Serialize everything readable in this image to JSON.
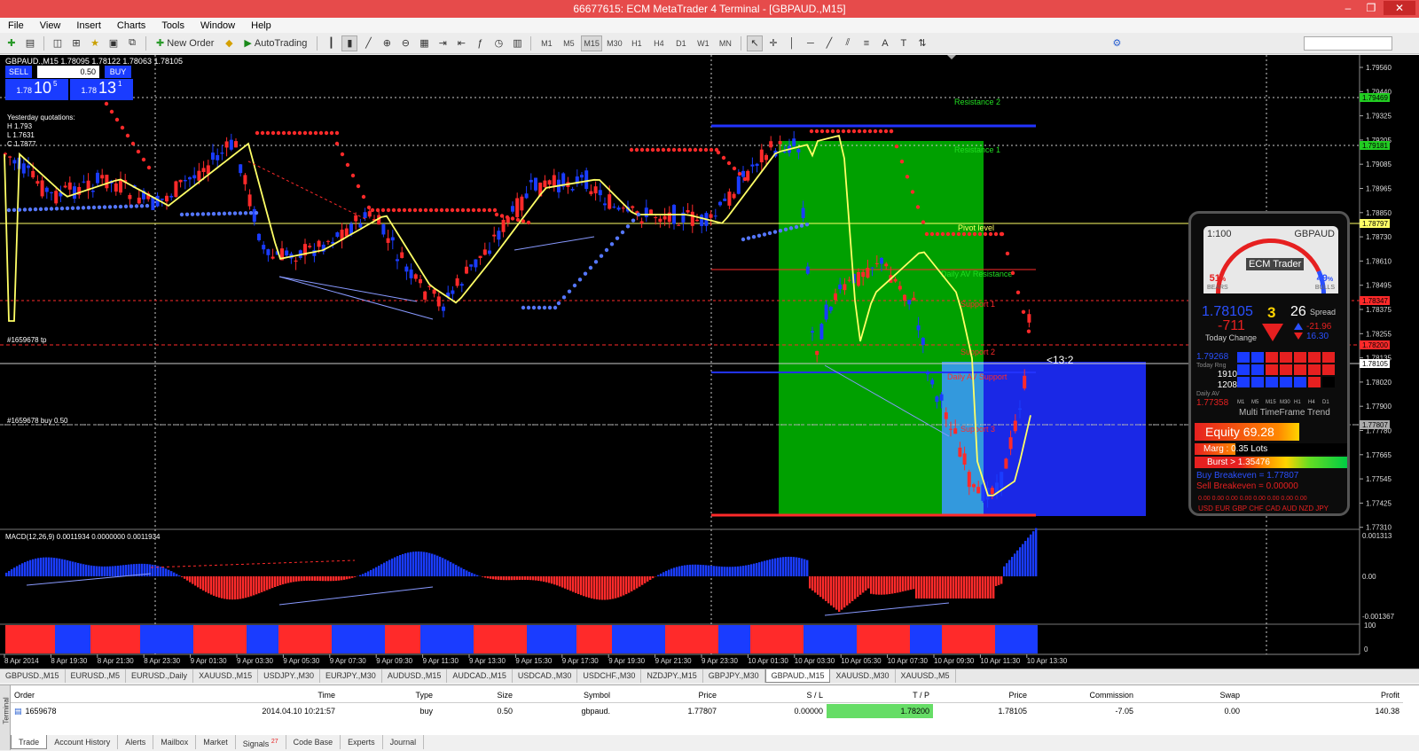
{
  "window": {
    "title": "66677615: ECM MetaTrader 4 Terminal - [GBPAUD.,M15]"
  },
  "menu": [
    "File",
    "View",
    "Insert",
    "Charts",
    "Tools",
    "Window",
    "Help"
  ],
  "toolbar": {
    "new_order": "New Order",
    "autotrading": "AutoTrading",
    "timeframes": [
      "M1",
      "M5",
      "M15",
      "M30",
      "H1",
      "H4",
      "D1",
      "W1",
      "MN"
    ],
    "active_timeframe": "M15"
  },
  "chart": {
    "symbol_label": "GBPAUD.,M15  1.78095 1.78122 1.78063 1.78105",
    "trade_panel": {
      "sell": "SELL",
      "buy": "BUY",
      "lot": "0.50",
      "sell_price_small": "1.78",
      "sell_price_big": "10",
      "sell_price_sup": "5",
      "buy_price_small": "1.78",
      "buy_price_big": "13",
      "buy_price_sup": "1"
    },
    "yesterday": [
      "Yesterday quotations:",
      "H 1.793",
      "L 1.7631",
      "C 1.7877"
    ],
    "levels": {
      "resistance2": "Resistance 2",
      "resistance1": "Resistance 1",
      "pivot": "Pivot level",
      "daily_av_resistance": "Daily AV Resistance",
      "support1": "Support 1",
      "support2": "Support 2",
      "daily_av_support": "Daily AV Support",
      "support3": "Support 3"
    },
    "order_tp_label": "#1659678 tp",
    "order_buy_label": "#1659678 buy 0.50",
    "countdown": "<13:2",
    "price_axis": [
      "1.79560",
      "1.79440",
      "1.79325",
      "1.79205",
      "1.79085",
      "1.78965",
      "1.78850",
      "1.78730",
      "1.78610",
      "1.78495",
      "1.78375",
      "1.78255",
      "1.78135",
      "1.78020",
      "1.77900",
      "1.77780",
      "1.77665",
      "1.77545",
      "1.77425",
      "1.77310"
    ],
    "price_tags": {
      "r2": "1.79469",
      "r1": "1.79181",
      "pivot": "1.78797",
      "res": "1.78347",
      "tp": "1.78200",
      "current": "1.78105",
      "buy": "1.77807"
    },
    "macd_label": "MACD(12,26,9) 0.0011934 0.0000000 0.0011934",
    "macd_axis": [
      "0.001313",
      "0.00",
      "-0.001367"
    ],
    "stoch_label": "Stochastic (M15,5,3,3,SMA,Low/High,80,20) 100.0000",
    "stoch_axis": [
      "100",
      "0"
    ],
    "time_axis": [
      "8 Apr 2014",
      "8 Apr 19:30",
      "8 Apr 21:30",
      "8 Apr 23:30",
      "9 Apr 01:30",
      "9 Apr 03:30",
      "9 Apr 05:30",
      "9 Apr 07:30",
      "9 Apr 09:30",
      "9 Apr 11:30",
      "9 Apr 13:30",
      "9 Apr 15:30",
      "9 Apr 17:30",
      "9 Apr 19:30",
      "9 Apr 21:30",
      "9 Apr 23:30",
      "10 Apr 01:30",
      "10 Apr 03:30",
      "10 Apr 05:30",
      "10 Apr 07:30",
      "10 Apr 09:30",
      "10 Apr 11:30",
      "10 Apr 13:30"
    ],
    "colors": {
      "bull": "#1a3cff",
      "bear": "#ff2a2a",
      "ma": "#ffff66",
      "green_zone": "#00a000",
      "blue_zone": "#1a28e6"
    }
  },
  "ecm": {
    "ratio": "1:100",
    "symbol": "GBPAUD",
    "title": "ECM Trader",
    "bears_pct": "51",
    "bulls_pct": "49",
    "bears": "BEARS",
    "bulls": "BULLS",
    "pct": "%",
    "price": "1.78105",
    "digit": "3",
    "spread_val": "26",
    "spread": "Spread",
    "change": "-711",
    "today_change": "Today Change",
    "chg1": "-21.96",
    "chg2": "16.30",
    "stat_high": "1.79268",
    "today_rng_label": "Today Rng",
    "rng1": "1910",
    "rng2": "1208",
    "daily_av_label": "Daily AV",
    "stat_low": "1.77358",
    "mtf_tfs": [
      "M1",
      "M5",
      "M15",
      "M30",
      "H1",
      "H4",
      "D1"
    ],
    "mtf_title": "Multi TimeFrame Trend",
    "equity": "Equity 69.28",
    "margin": "Marg   : 0.35 Lots",
    "burst": "Burst > 1.35476",
    "buy_be": "Buy Breakeven = 1.77807",
    "sell_be": "Sell Breakeven = 0.00000",
    "cur_vals": "0.00 0.00 0.00 0.00 0.00 0.00 0.00 0.00",
    "cur_names": "USD EUR GBP CHF CAD AUD NZD JPY"
  },
  "chart_tabs": [
    "GBPUSD.,M15",
    "EURUSD.,M5",
    "EURUSD.,Daily",
    "XAUUSD.,M15",
    "USDJPY.,M30",
    "EURJPY.,M30",
    "AUDUSD.,M15",
    "AUDCAD.,M15",
    "USDCAD.,M30",
    "USDCHF.,M30",
    "NZDJPY.,M15",
    "GBPJPY.,M30",
    "GBPAUD.,M15",
    "XAUUSD.,M30",
    "XAUUSD.,M5"
  ],
  "active_chart_tab": "GBPAUD.,M15",
  "terminal": {
    "side_label": "Terminal",
    "headers": [
      "Order",
      "Time",
      "Type",
      "Size",
      "Symbol",
      "Price",
      "S / L",
      "T / P",
      "Price",
      "Commission",
      "Swap",
      "Profit"
    ],
    "row": [
      "1659678",
      "2014.04.10 10:21:57",
      "buy",
      "0.50",
      "gbpaud.",
      "1.77807",
      "0.00000",
      "1.78200",
      "1.78105",
      "-7.05",
      "0.00",
      "140.38"
    ],
    "tabs": [
      "Trade",
      "Account History",
      "Alerts",
      "Mailbox",
      "Market",
      "Signals",
      "Code Base",
      "Experts",
      "Journal"
    ],
    "signals_badge": "27"
  }
}
